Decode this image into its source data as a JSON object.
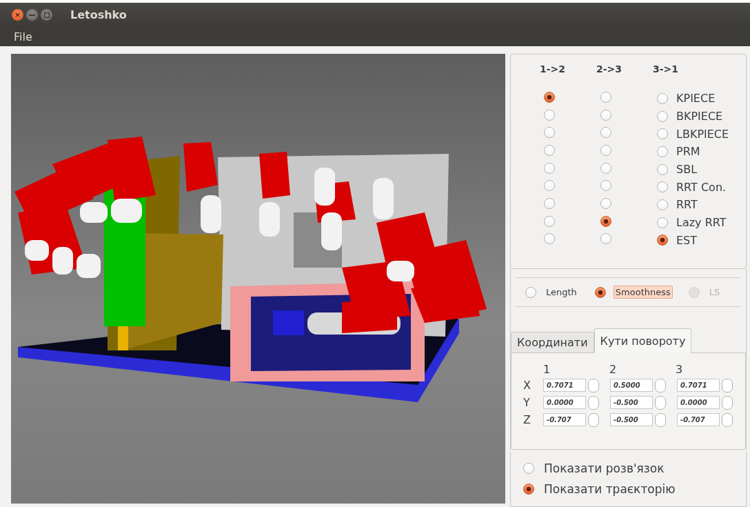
{
  "window": {
    "title": "Letoshko"
  },
  "menu": [
    "File"
  ],
  "planner_columns": [
    "1->2",
    "2->3",
    "3->1"
  ],
  "planners": [
    {
      "name": "KPIECE",
      "picks": [
        {
          "selected": true
        },
        {
          "selected": false
        },
        {
          "selected": false
        }
      ]
    },
    {
      "name": "BKPIECE",
      "picks": [
        {
          "selected": false
        },
        {
          "selected": false
        },
        {
          "selected": false
        }
      ]
    },
    {
      "name": "LBKPIECE",
      "picks": [
        {
          "selected": false
        },
        {
          "selected": false
        },
        {
          "selected": false
        }
      ]
    },
    {
      "name": "PRM",
      "picks": [
        {
          "selected": false
        },
        {
          "selected": false
        },
        {
          "selected": false
        }
      ]
    },
    {
      "name": "SBL",
      "picks": [
        {
          "selected": false
        },
        {
          "selected": false
        },
        {
          "selected": false
        }
      ]
    },
    {
      "name": "RRT Con.",
      "picks": [
        {
          "selected": false
        },
        {
          "selected": false
        },
        {
          "selected": false
        }
      ]
    },
    {
      "name": "RRT",
      "picks": [
        {
          "selected": false
        },
        {
          "selected": false
        },
        {
          "selected": false
        }
      ]
    },
    {
      "name": "Lazy RRT",
      "picks": [
        {
          "selected": false
        },
        {
          "selected": true
        },
        {
          "selected": false
        }
      ]
    },
    {
      "name": "EST",
      "picks": [
        {
          "selected": false
        },
        {
          "selected": false
        },
        {
          "selected": true
        }
      ]
    }
  ],
  "metrics": [
    {
      "label": "Length",
      "selected": false,
      "disabled": false
    },
    {
      "label": "Smoothness",
      "selected": true,
      "disabled": false
    },
    {
      "label": "LS",
      "selected": false,
      "disabled": true
    }
  ],
  "tabs": [
    {
      "label": "Координати",
      "selected": false
    },
    {
      "label": "Кути повороту",
      "selected": true
    }
  ],
  "angles": {
    "columns": [
      "1",
      "2",
      "3"
    ],
    "rows": [
      {
        "axis": "X",
        "cells": [
          {
            "value": "0.7071",
            "checked": false
          },
          {
            "value": "0.5000",
            "checked": false
          },
          {
            "value": "0.7071",
            "checked": false
          }
        ]
      },
      {
        "axis": "Y",
        "cells": [
          {
            "value": "0.0000",
            "checked": false
          },
          {
            "value": "-0.500",
            "checked": false
          },
          {
            "value": "0.0000",
            "checked": false
          }
        ]
      },
      {
        "axis": "Z",
        "cells": [
          {
            "value": "-0.707",
            "checked": false
          },
          {
            "value": "-0.500",
            "checked": false
          },
          {
            "value": "-0.707",
            "checked": false
          }
        ]
      }
    ]
  },
  "display_options": [
    {
      "label": "Показати розв'язок",
      "selected": false
    },
    {
      "label": "Показати траєкторію",
      "selected": true
    }
  ]
}
